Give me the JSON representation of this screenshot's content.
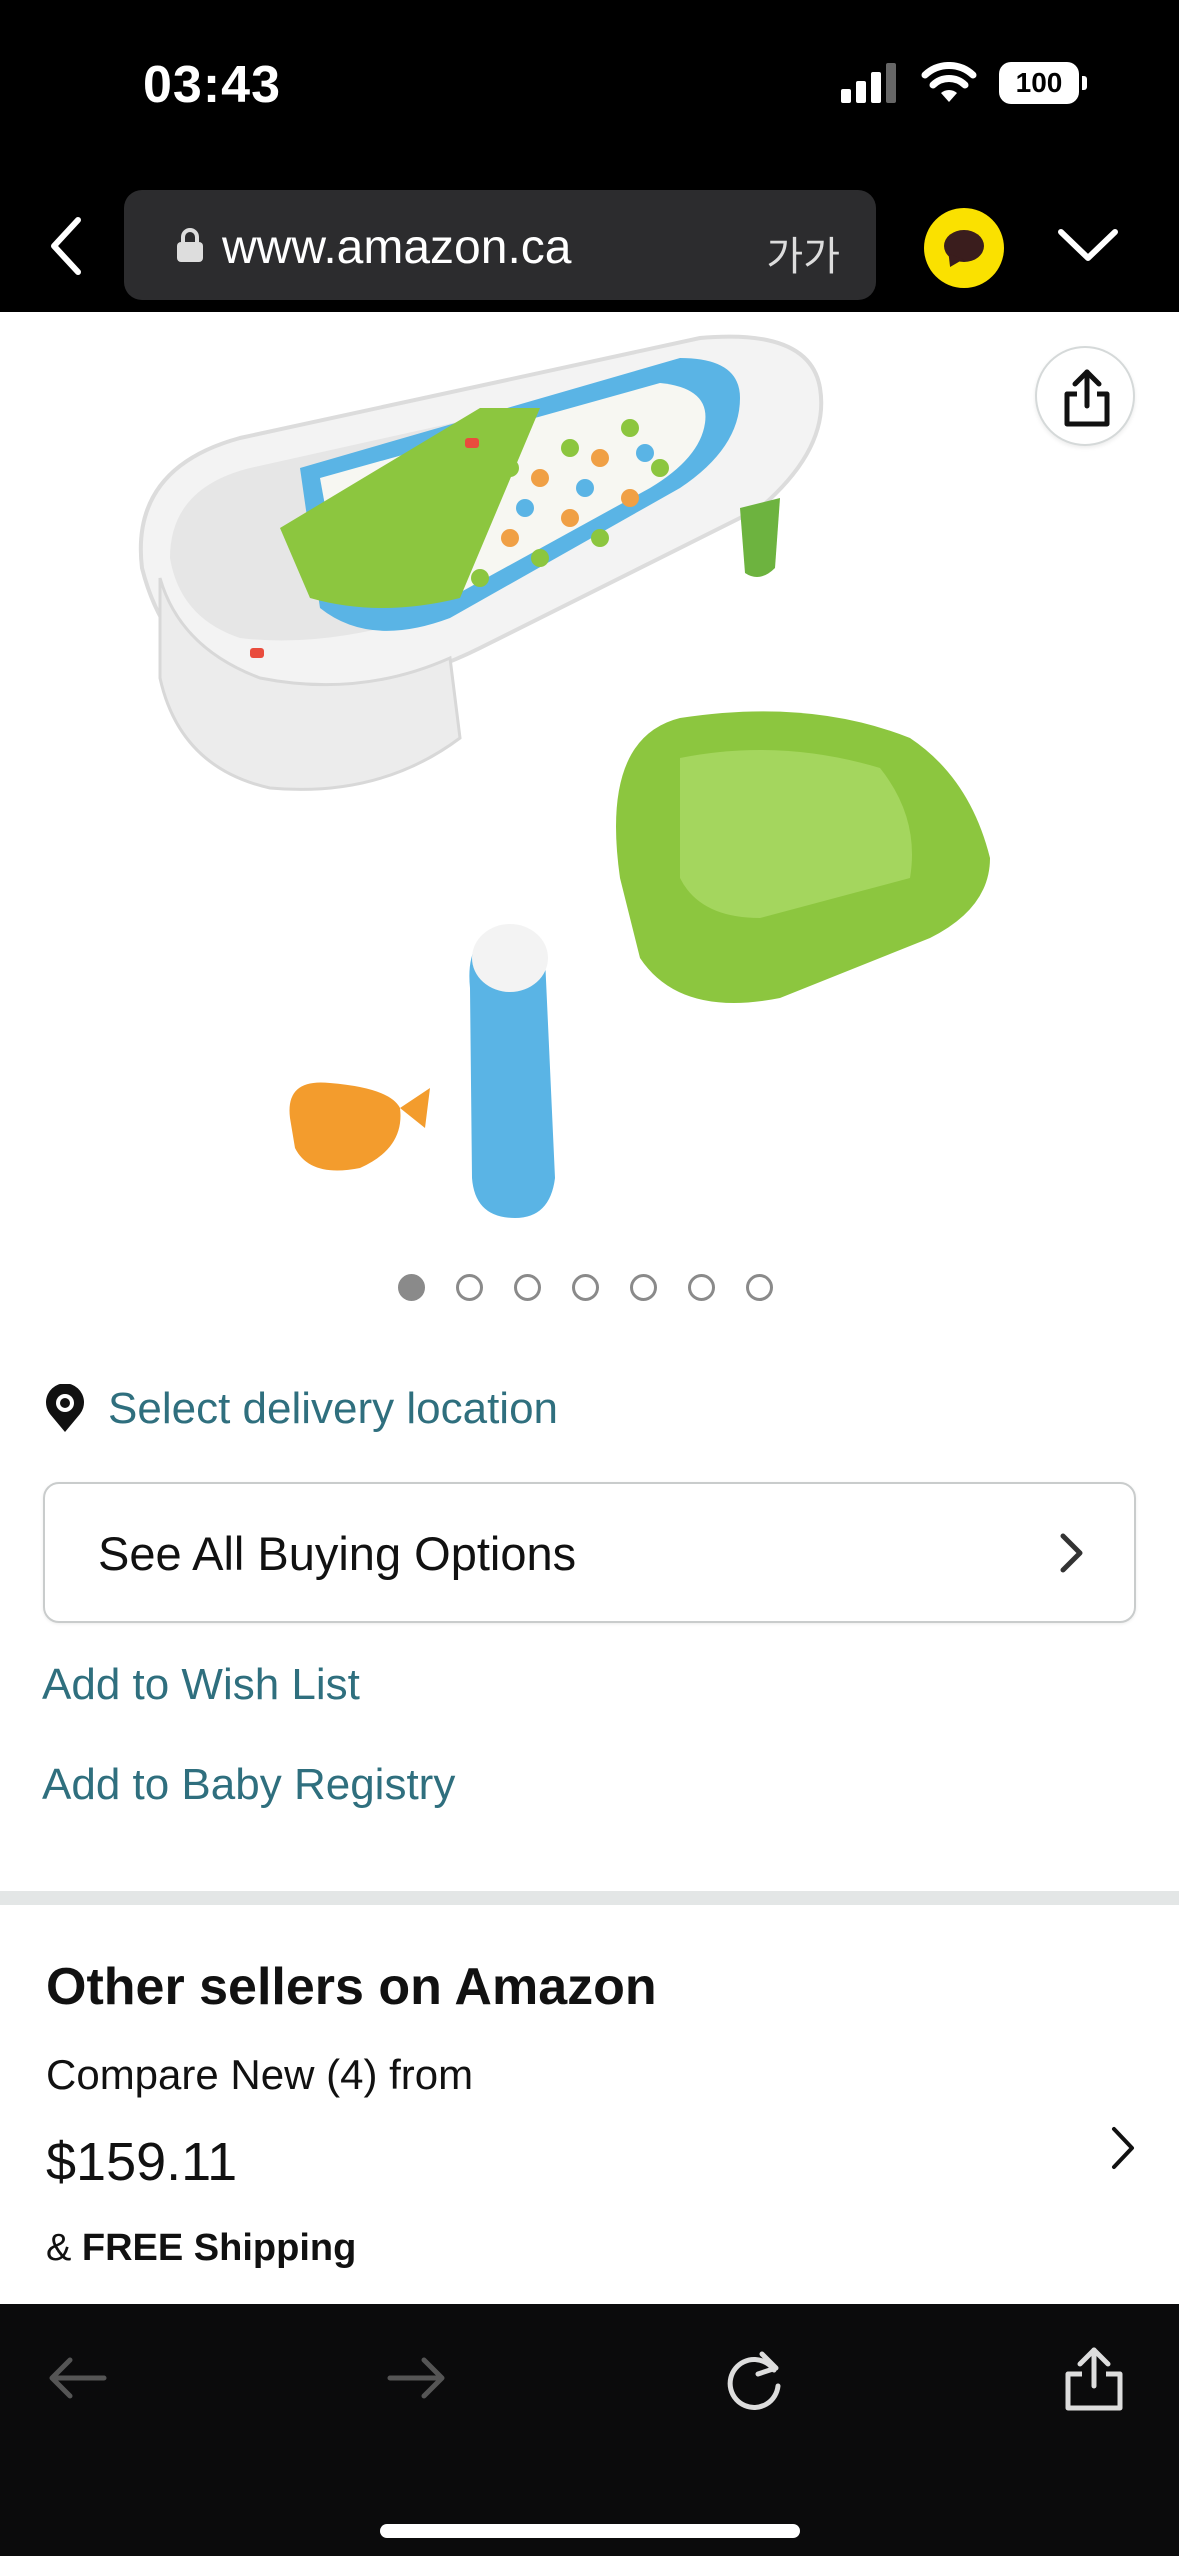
{
  "status_bar": {
    "time": "03:43",
    "battery": "100"
  },
  "browser": {
    "url": "www.amazon.ca",
    "text_size_label": "가가",
    "icons": {
      "back": "chevron-left-icon",
      "lock": "lock-icon",
      "talk": "kakaotalk-icon",
      "more": "chevron-down-icon"
    }
  },
  "product": {
    "image_icon": "product-image",
    "share_icon": "share-icon",
    "carousel": {
      "total": 7,
      "active_index": 0
    }
  },
  "delivery": {
    "label": "Select delivery location",
    "icon": "location-pin-icon"
  },
  "buying_options": {
    "label": "See All Buying Options",
    "icon": "chevron-right-icon"
  },
  "links": {
    "wish_list": "Add to Wish List",
    "baby_registry": "Add to Baby Registry"
  },
  "other_sellers": {
    "title": "Other sellers on Amazon",
    "compare": "Compare New (4) from",
    "price": "$159.11",
    "shipping_prefix": "& ",
    "shipping_bold": "FREE Shipping"
  },
  "bottom_toolbar": {
    "icons": [
      "arrow-left-icon",
      "arrow-right-icon",
      "refresh-icon",
      "share-icon"
    ]
  },
  "colors": {
    "link": "#2f6f7e",
    "talk_yellow": "#fae100",
    "tub_green": "#8cc63f",
    "tub_blue": "#5ab4e5"
  }
}
